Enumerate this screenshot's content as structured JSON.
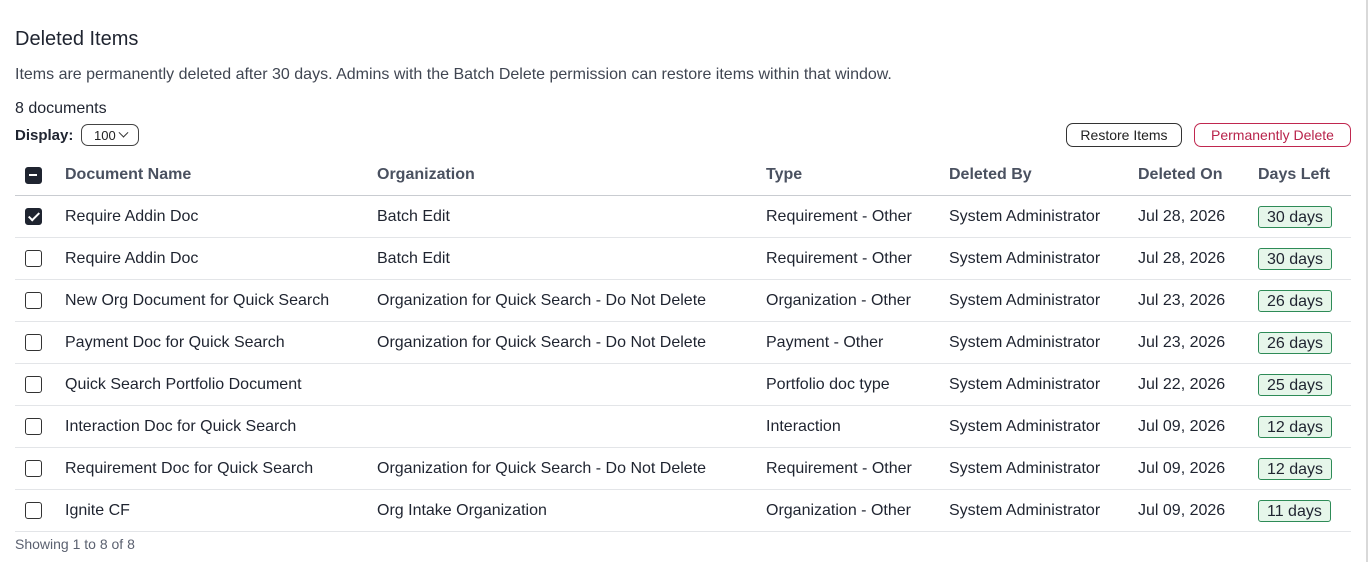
{
  "page": {
    "title": "Deleted Items",
    "description": "Items are permanently deleted after 30 days. Admins with the Batch Delete permission can restore items within that window.",
    "document_count": "8 documents",
    "display_label": "Display:",
    "display_value": "100",
    "footer": "Showing 1 to 8 of 8"
  },
  "toolbar": {
    "restore_label": "Restore Items",
    "delete_label": "Permanently Delete"
  },
  "colors": {
    "delete_accent": "#b8234b",
    "badge_border": "#2e8b57",
    "badge_bg": "#e6f6ea"
  },
  "table": {
    "headers": [
      "Document Name",
      "Organization",
      "Type",
      "Deleted By",
      "Deleted On",
      "Days Left"
    ],
    "select_all_state": "indeterminate",
    "rows": [
      {
        "checked": true,
        "name": "Require Addin Doc",
        "organization": "Batch Edit",
        "type": "Requirement - Other",
        "deleted_by": "System Administrator",
        "deleted_on": "Jul 28, 2026",
        "days_left": "30 days"
      },
      {
        "checked": false,
        "name": "Require Addin Doc",
        "organization": "Batch Edit",
        "type": "Requirement - Other",
        "deleted_by": "System Administrator",
        "deleted_on": "Jul 28, 2026",
        "days_left": "30 days"
      },
      {
        "checked": false,
        "name": "New Org Document for Quick Search",
        "organization": "Organization for Quick Search - Do Not Delete",
        "type": "Organization - Other",
        "deleted_by": "System Administrator",
        "deleted_on": "Jul 23, 2026",
        "days_left": "26 days"
      },
      {
        "checked": false,
        "name": "Payment Doc for Quick Search",
        "organization": "Organization for Quick Search - Do Not Delete",
        "type": "Payment - Other",
        "deleted_by": "System Administrator",
        "deleted_on": "Jul 23, 2026",
        "days_left": "26 days"
      },
      {
        "checked": false,
        "name": "Quick Search Portfolio Document",
        "organization": "",
        "type": "Portfolio doc type",
        "deleted_by": "System Administrator",
        "deleted_on": "Jul 22, 2026",
        "days_left": "25 days"
      },
      {
        "checked": false,
        "name": "Interaction Doc for Quick Search",
        "organization": "",
        "type": "Interaction",
        "deleted_by": "System Administrator",
        "deleted_on": "Jul 09, 2026",
        "days_left": "12 days"
      },
      {
        "checked": false,
        "name": "Requirement Doc for Quick Search",
        "organization": "Organization for Quick Search - Do Not Delete",
        "type": "Requirement - Other",
        "deleted_by": "System Administrator",
        "deleted_on": "Jul 09, 2026",
        "days_left": "12 days"
      },
      {
        "checked": false,
        "name": "Ignite CF",
        "organization": "Org Intake Organization",
        "type": "Organization - Other",
        "deleted_by": "System Administrator",
        "deleted_on": "Jul 09, 2026",
        "days_left": "11 days"
      }
    ]
  }
}
